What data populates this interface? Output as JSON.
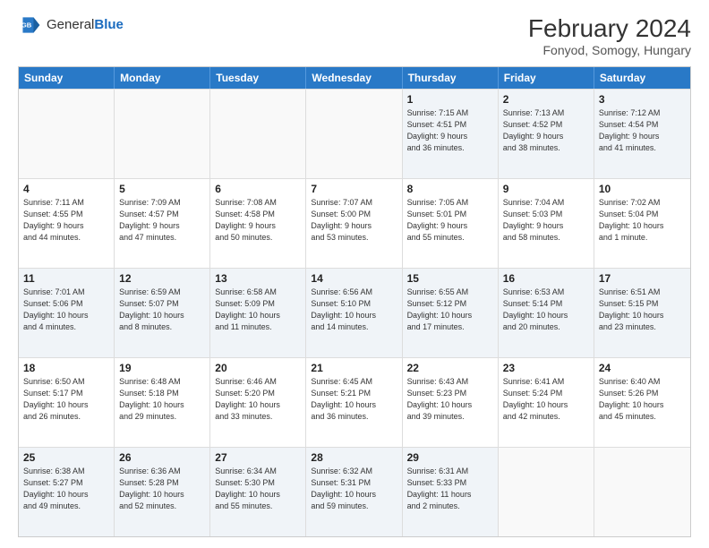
{
  "header": {
    "logo": {
      "general": "General",
      "blue": "Blue"
    },
    "title": "February 2024",
    "subtitle": "Fonyod, Somogy, Hungary"
  },
  "calendar": {
    "headers": [
      "Sunday",
      "Monday",
      "Tuesday",
      "Wednesday",
      "Thursday",
      "Friday",
      "Saturday"
    ],
    "rows": [
      [
        {
          "day": "",
          "info": "",
          "empty": true
        },
        {
          "day": "",
          "info": "",
          "empty": true
        },
        {
          "day": "",
          "info": "",
          "empty": true
        },
        {
          "day": "",
          "info": "",
          "empty": true
        },
        {
          "day": "1",
          "info": "Sunrise: 7:15 AM\nSunset: 4:51 PM\nDaylight: 9 hours\nand 36 minutes."
        },
        {
          "day": "2",
          "info": "Sunrise: 7:13 AM\nSunset: 4:52 PM\nDaylight: 9 hours\nand 38 minutes."
        },
        {
          "day": "3",
          "info": "Sunrise: 7:12 AM\nSunset: 4:54 PM\nDaylight: 9 hours\nand 41 minutes."
        }
      ],
      [
        {
          "day": "4",
          "info": "Sunrise: 7:11 AM\nSunset: 4:55 PM\nDaylight: 9 hours\nand 44 minutes."
        },
        {
          "day": "5",
          "info": "Sunrise: 7:09 AM\nSunset: 4:57 PM\nDaylight: 9 hours\nand 47 minutes."
        },
        {
          "day": "6",
          "info": "Sunrise: 7:08 AM\nSunset: 4:58 PM\nDaylight: 9 hours\nand 50 minutes."
        },
        {
          "day": "7",
          "info": "Sunrise: 7:07 AM\nSunset: 5:00 PM\nDaylight: 9 hours\nand 53 minutes."
        },
        {
          "day": "8",
          "info": "Sunrise: 7:05 AM\nSunset: 5:01 PM\nDaylight: 9 hours\nand 55 minutes."
        },
        {
          "day": "9",
          "info": "Sunrise: 7:04 AM\nSunset: 5:03 PM\nDaylight: 9 hours\nand 58 minutes."
        },
        {
          "day": "10",
          "info": "Sunrise: 7:02 AM\nSunset: 5:04 PM\nDaylight: 10 hours\nand 1 minute."
        }
      ],
      [
        {
          "day": "11",
          "info": "Sunrise: 7:01 AM\nSunset: 5:06 PM\nDaylight: 10 hours\nand 4 minutes."
        },
        {
          "day": "12",
          "info": "Sunrise: 6:59 AM\nSunset: 5:07 PM\nDaylight: 10 hours\nand 8 minutes."
        },
        {
          "day": "13",
          "info": "Sunrise: 6:58 AM\nSunset: 5:09 PM\nDaylight: 10 hours\nand 11 minutes."
        },
        {
          "day": "14",
          "info": "Sunrise: 6:56 AM\nSunset: 5:10 PM\nDaylight: 10 hours\nand 14 minutes."
        },
        {
          "day": "15",
          "info": "Sunrise: 6:55 AM\nSunset: 5:12 PM\nDaylight: 10 hours\nand 17 minutes."
        },
        {
          "day": "16",
          "info": "Sunrise: 6:53 AM\nSunset: 5:14 PM\nDaylight: 10 hours\nand 20 minutes."
        },
        {
          "day": "17",
          "info": "Sunrise: 6:51 AM\nSunset: 5:15 PM\nDaylight: 10 hours\nand 23 minutes."
        }
      ],
      [
        {
          "day": "18",
          "info": "Sunrise: 6:50 AM\nSunset: 5:17 PM\nDaylight: 10 hours\nand 26 minutes."
        },
        {
          "day": "19",
          "info": "Sunrise: 6:48 AM\nSunset: 5:18 PM\nDaylight: 10 hours\nand 29 minutes."
        },
        {
          "day": "20",
          "info": "Sunrise: 6:46 AM\nSunset: 5:20 PM\nDaylight: 10 hours\nand 33 minutes."
        },
        {
          "day": "21",
          "info": "Sunrise: 6:45 AM\nSunset: 5:21 PM\nDaylight: 10 hours\nand 36 minutes."
        },
        {
          "day": "22",
          "info": "Sunrise: 6:43 AM\nSunset: 5:23 PM\nDaylight: 10 hours\nand 39 minutes."
        },
        {
          "day": "23",
          "info": "Sunrise: 6:41 AM\nSunset: 5:24 PM\nDaylight: 10 hours\nand 42 minutes."
        },
        {
          "day": "24",
          "info": "Sunrise: 6:40 AM\nSunset: 5:26 PM\nDaylight: 10 hours\nand 45 minutes."
        }
      ],
      [
        {
          "day": "25",
          "info": "Sunrise: 6:38 AM\nSunset: 5:27 PM\nDaylight: 10 hours\nand 49 minutes."
        },
        {
          "day": "26",
          "info": "Sunrise: 6:36 AM\nSunset: 5:28 PM\nDaylight: 10 hours\nand 52 minutes."
        },
        {
          "day": "27",
          "info": "Sunrise: 6:34 AM\nSunset: 5:30 PM\nDaylight: 10 hours\nand 55 minutes."
        },
        {
          "day": "28",
          "info": "Sunrise: 6:32 AM\nSunset: 5:31 PM\nDaylight: 10 hours\nand 59 minutes."
        },
        {
          "day": "29",
          "info": "Sunrise: 6:31 AM\nSunset: 5:33 PM\nDaylight: 11 hours\nand 2 minutes."
        },
        {
          "day": "",
          "info": "",
          "empty": true
        },
        {
          "day": "",
          "info": "",
          "empty": true
        }
      ]
    ]
  }
}
